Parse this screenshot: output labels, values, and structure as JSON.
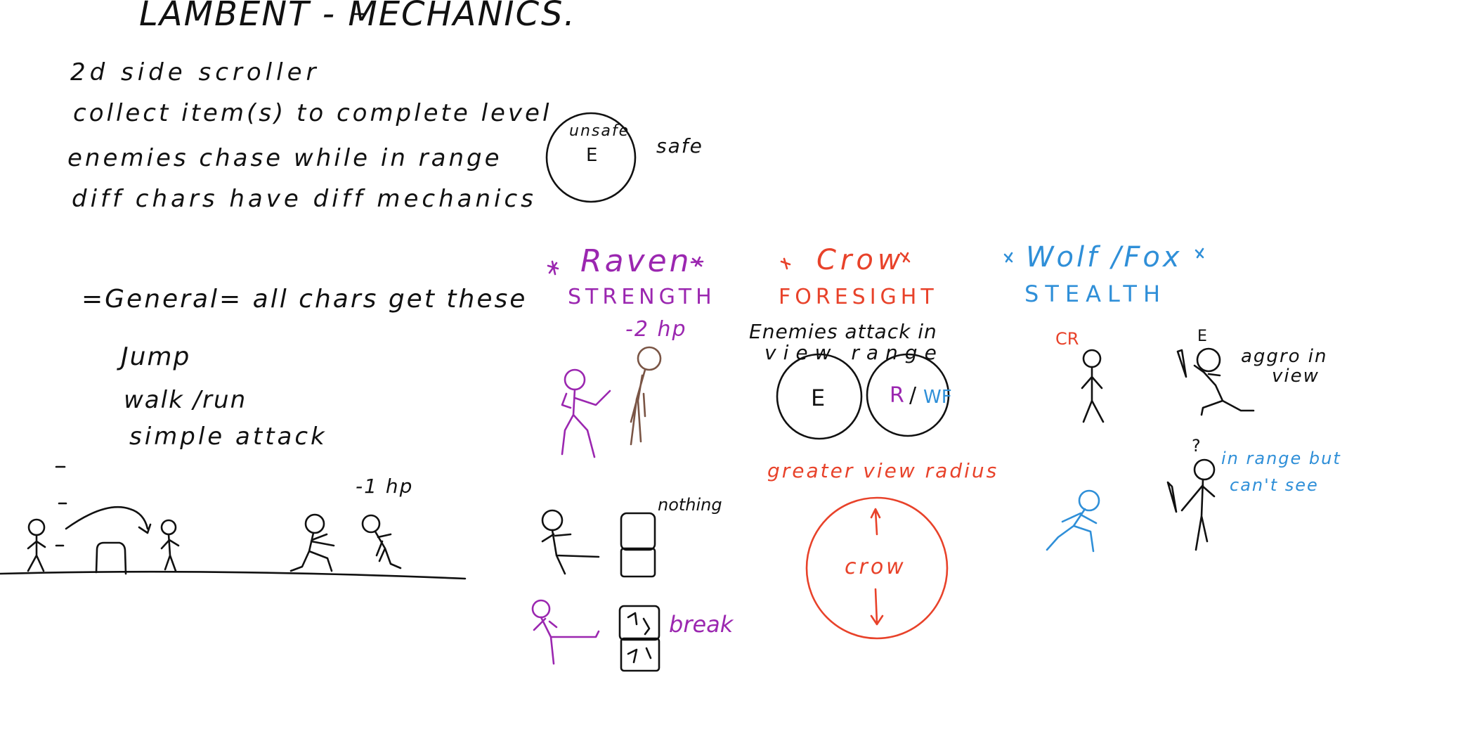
{
  "colors": {
    "black": "#111111",
    "raven": "#9b27b0",
    "crow": "#e8422a",
    "wolf": "#2f8fd8",
    "brown": "#7a5545"
  },
  "title": "LAMBENT - MECHANICS.",
  "intro": [
    "2d side scroller",
    "collect item(s) to complete level",
    "enemies chase while in range",
    "diff chars have diff mechanics"
  ],
  "safe_zone": {
    "unsafe_label": "unsafe",
    "enemy_label": "E",
    "safe_label": "safe"
  },
  "general": {
    "heading": "=General= all chars get these",
    "moves": [
      "Jump",
      "walk /run",
      "simple attack"
    ],
    "damage_label": "-1 hp"
  },
  "raven": {
    "name": "Raven",
    "ability": "STRENGTH",
    "damage_label": "-2 hp",
    "nothing_label": "nothing",
    "break_label": "break"
  },
  "crow": {
    "name": "Crow",
    "ability": "FORESIGHT",
    "note": [
      "Enemies attack in",
      "view range"
    ],
    "enemy_label": "E",
    "r_label": "R",
    "slash": "/",
    "wf_label": "WF",
    "radius_label": "greater view radius",
    "circle_label": "crow"
  },
  "wolf": {
    "name": "Wolf /Fox",
    "ability": "STEALTH",
    "cr_label": "CR",
    "enemy_label": "E",
    "aggro_note": [
      "aggro in",
      "view"
    ],
    "question": "?",
    "hidden_note": [
      "in range but",
      "can't see"
    ]
  }
}
